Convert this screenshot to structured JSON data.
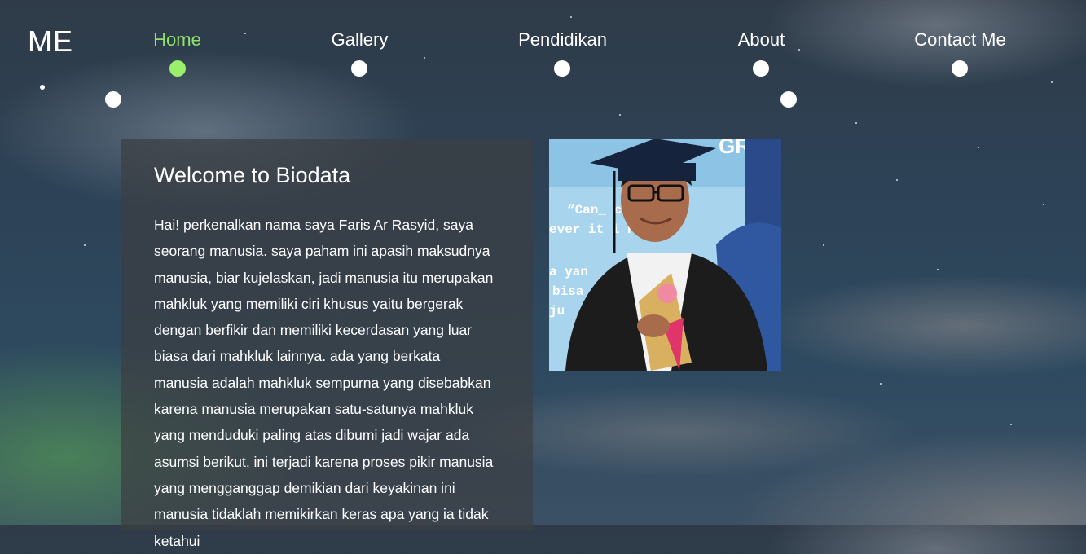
{
  "logo": "ME",
  "nav": [
    {
      "label": "Home",
      "active": true
    },
    {
      "label": "Gallery",
      "active": false
    },
    {
      "label": "Pendidikan",
      "active": false
    },
    {
      "label": "About",
      "active": false
    },
    {
      "label": "Contact Me",
      "active": false
    }
  ],
  "colors": {
    "accent": "#8fe26a",
    "text": "#ffffff",
    "card_bg": "#3c3e42"
  },
  "card": {
    "title": "Welcome to Biodata",
    "body": "Hai! perkenalkan nama saya Faris Ar Rasyid, saya seorang manusia. saya paham ini apasih maksudnya manusia, biar kujelaskan, jadi manusia itu merupakan mahkluk yang memiliki ciri khusus yaitu bergerak dengan berfikir dan memiliki kecerdasan yang luar biasa dari mahkluk lainnya. ada yang berkata manusia adalah mahkluk sempurna yang disebabkan karena manusia merupakan satu-satunya mahkluk yang menduduki paling atas dibumi jadi wajar ada asumsi berikut, ini terjadi karena proses pikir manusia yang mengganggap demikian dari keyakinan ini manusia tidaklah memikirkan keras apa yang ia tidak ketahui"
  },
  "photo": {
    "banner_text": "GRA",
    "quote_line1": "“Can_ co see w",
    "quote_line2": "ever it i Pr",
    "quote_line3": "a yan",
    "quote_line4": "bisa",
    "quote_line5": "ju"
  }
}
